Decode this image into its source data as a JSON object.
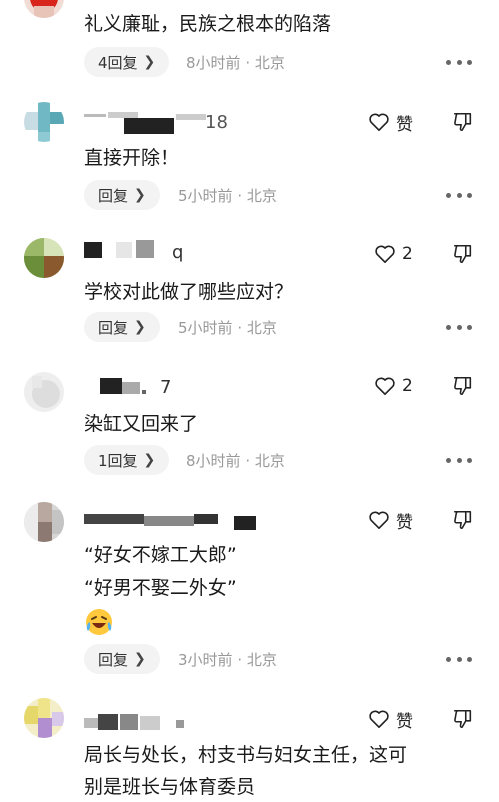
{
  "comments": [
    {
      "text_lines": [
        "礼义廉耻，民族之根本的陷落"
      ],
      "reply_label": "4回复",
      "time": "8小时前",
      "location": "北京"
    },
    {
      "name_fragment": "18",
      "text_lines": [
        "直接开除！"
      ],
      "like_label": "赞",
      "reply_label": "回复",
      "time": "5小时前",
      "location": "北京"
    },
    {
      "name_fragment": "q",
      "text_lines": [
        "学校对此做了哪些应对？"
      ],
      "like_label": "2",
      "reply_label": "回复",
      "time": "5小时前",
      "location": "北京"
    },
    {
      "name_fragment": "7",
      "text_lines": [
        "染缸又回来了"
      ],
      "like_label": "2",
      "reply_label": "1回复",
      "time": "8小时前",
      "location": "北京"
    },
    {
      "text_lines": [
        "“好女不嫁工大郎”",
        "“好男不娶二外女”"
      ],
      "emoji": "laughing-crying-emoji",
      "like_label": "赞",
      "reply_label": "回复",
      "time": "3小时前",
      "location": "北京"
    },
    {
      "name_fragment": "",
      "text_lines": [
        "局长与处长，村支书与妇女主任，这可",
        "别是班长与体育委员"
      ],
      "like_label": "赞"
    }
  ],
  "separator": "·",
  "icons": {
    "like": "heart-outline-icon",
    "dislike": "thumbs-down-outline-icon",
    "more": "more-dots-icon",
    "reply_arrow": "chevron-right-icon"
  }
}
